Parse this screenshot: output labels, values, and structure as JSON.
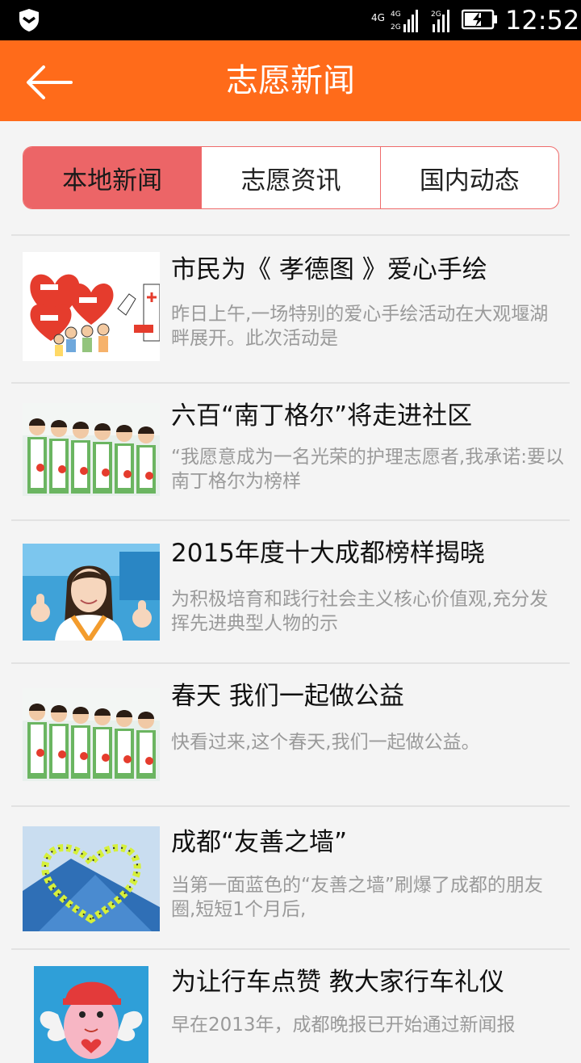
{
  "status_bar": {
    "time": "12:52",
    "network_primary": "4G",
    "network_secondary": "2G"
  },
  "header": {
    "title": "志愿新闻",
    "back_icon": "back-arrow-icon",
    "color": "#ff6b1a"
  },
  "tabs": [
    {
      "label": "本地新闻",
      "active": true
    },
    {
      "label": "志愿资讯",
      "active": false
    },
    {
      "label": "国内动态",
      "active": false
    }
  ],
  "news": [
    {
      "title": "市民为《 孝德图 》爱心手绘",
      "summary": "昨日上午,一场特别的爱心手绘活动在大观堰湖畔展开。此次活动是",
      "image": "heart-drawing-illustration"
    },
    {
      "title": "六百“南丁格尔”将走进社区",
      "summary": "“我愿意成为一名光荣的护理志愿者,我承诺:要以南丁格尔为榜样",
      "image": "volunteer-nurses-photo"
    },
    {
      "title": "2015年度十大成都榜样揭晓",
      "summary": "为积极培育和践行社会主义核心价值观,充分发挥先进典型人物的示",
      "image": "smiling-volunteer-photo"
    },
    {
      "title": "春天 我们一起做公益",
      "summary": "快看过来,这个春天,我们一起做公益。",
      "image": "volunteer-nurses-photo"
    },
    {
      "title": "成都“友善之墙”",
      "summary": "当第一面蓝色的“友善之墙”刷爆了成都的朋友圈,短短1个月后,",
      "image": "heart-formation-photo"
    },
    {
      "title": "为让行车点赞 教大家行车礼仪",
      "summary": "早在2013年，成都晚报已开始通过新闻报",
      "image": "mascot-illustration"
    }
  ]
}
